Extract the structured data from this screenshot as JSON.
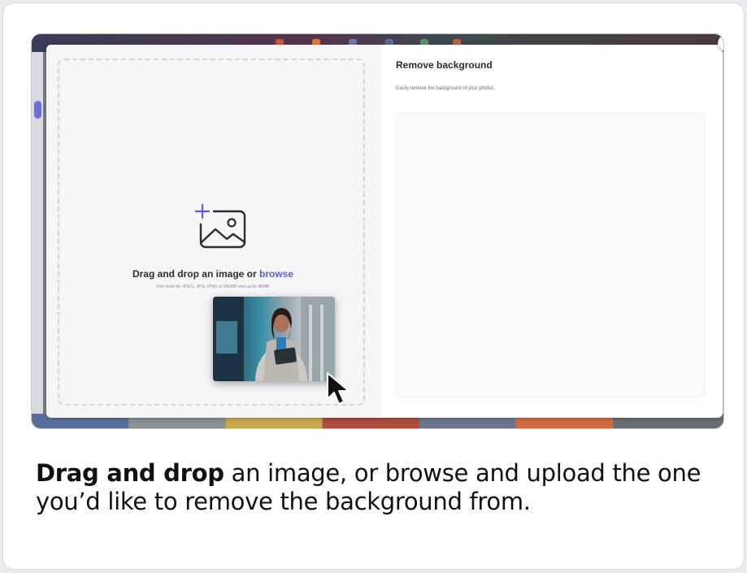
{
  "modal": {
    "title": "Remove background",
    "description": "Easily remove the background of your photos.",
    "close_label": "✕",
    "dropzone": {
      "drag_text": "Drag and drop an image or",
      "browse_link": "browse",
      "hint": "File must be JPEG, JPG, PNG or WEBP and up to 40MB"
    }
  },
  "caption": {
    "bold": "Drag and drop",
    "rest": " an image, or browse and upload the one you’d like to remove the background from."
  },
  "colors": {
    "accent": "#5c5ce0"
  },
  "icons": {
    "dropzone_icon": "image-plus-icon",
    "cursor": "mouse-pointer-icon"
  }
}
